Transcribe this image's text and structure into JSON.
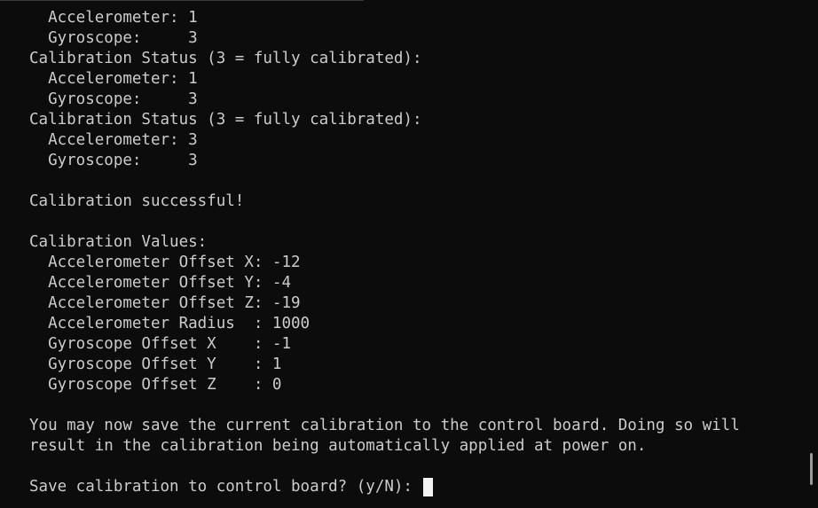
{
  "terminal": {
    "lines": [
      "  Accelerometer: 1",
      "  Gyroscope:     3",
      "Calibration Status (3 = fully calibrated):",
      "  Accelerometer: 1",
      "  Gyroscope:     3",
      "Calibration Status (3 = fully calibrated):",
      "  Accelerometer: 3",
      "  Gyroscope:     3",
      "",
      "Calibration successful!",
      "",
      "Calibration Values:",
      "  Accelerometer Offset X: -12",
      "  Accelerometer Offset Y: -4",
      "  Accelerometer Offset Z: -19",
      "  Accelerometer Radius  : 1000",
      "  Gyroscope Offset X    : -1",
      "  Gyroscope Offset Y    : 1",
      "  Gyroscope Offset Z    : 0",
      "",
      "You may now save the current calibration to the control board. Doing so will",
      "result in the calibration being automatically applied at power on.",
      ""
    ],
    "prompt": "Save calibration to control board? (y/N): "
  },
  "colors": {
    "background": "#0c0c0c",
    "text": "#cccccc",
    "cursor": "#f2f2f2"
  }
}
